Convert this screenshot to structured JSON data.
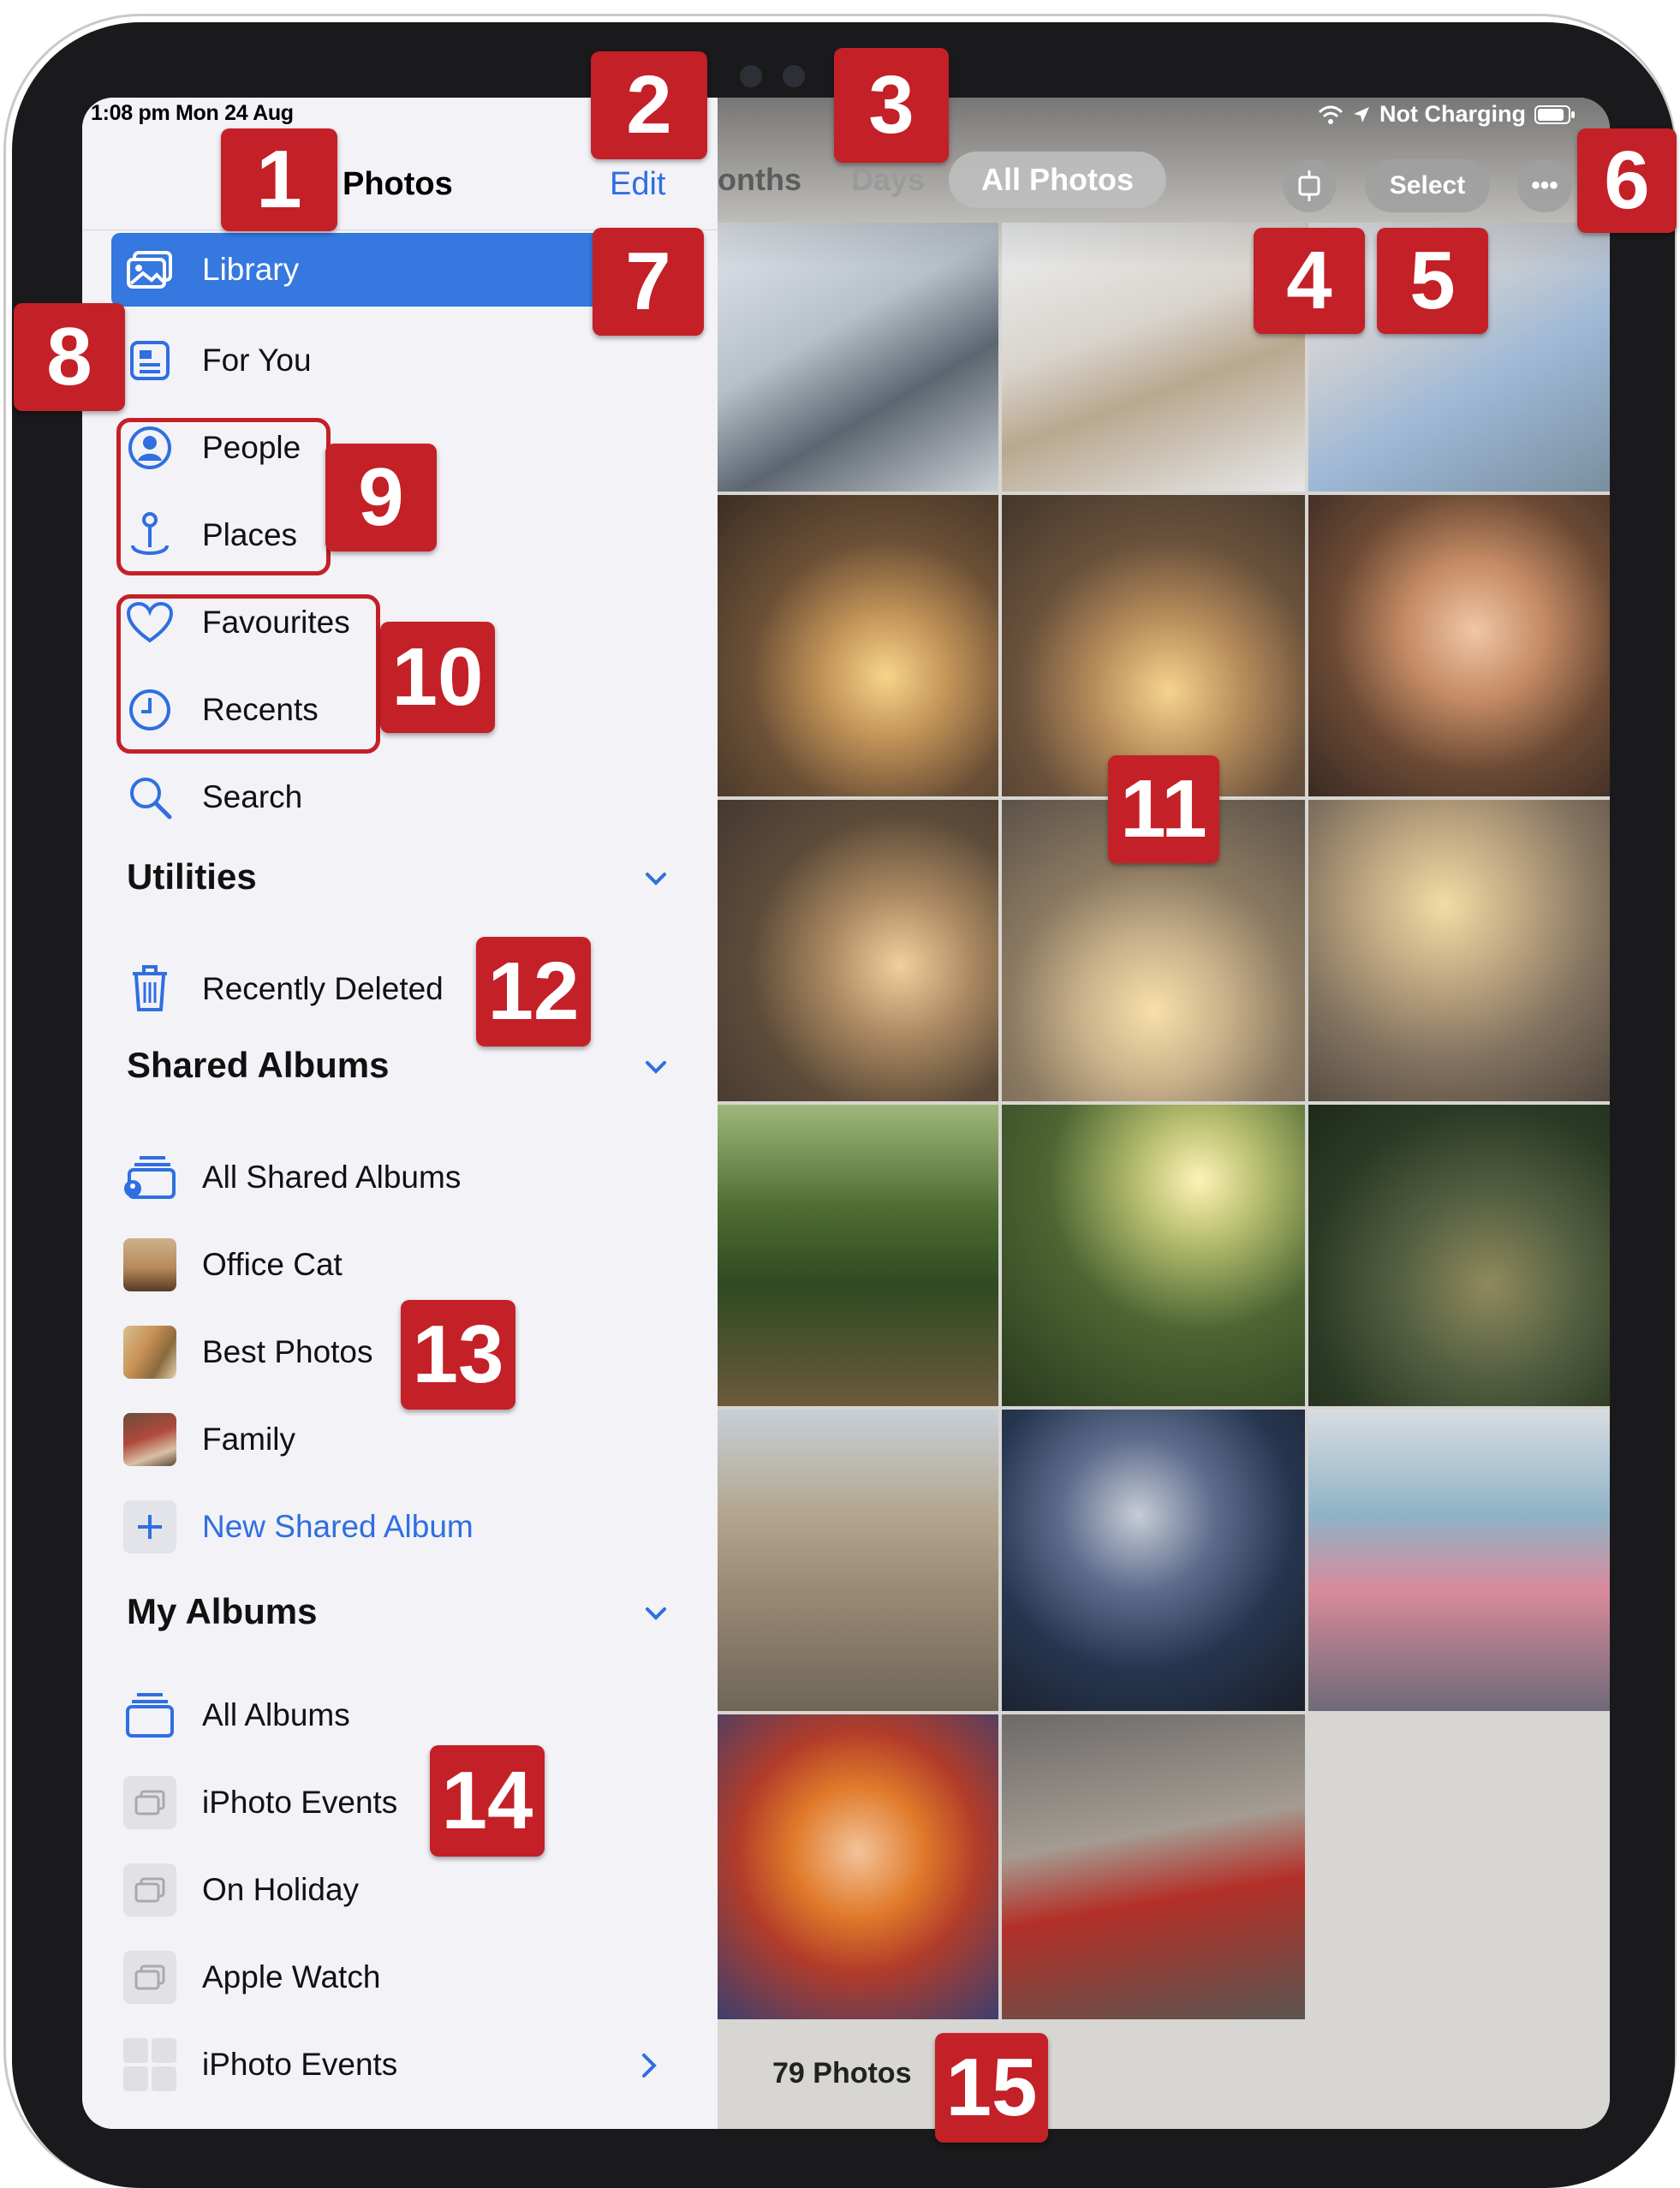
{
  "status_bar": {
    "time_date": "1:08 pm  Mon 24 Aug",
    "charging": "Not Charging"
  },
  "sidebar": {
    "title": "Photos",
    "edit_label": "Edit",
    "items": [
      {
        "label": "Library",
        "icon": "library-icon"
      },
      {
        "label": "For You",
        "icon": "for-you-icon"
      },
      {
        "label": "People",
        "icon": "people-icon"
      },
      {
        "label": "Places",
        "icon": "places-icon"
      },
      {
        "label": "Favourites",
        "icon": "heart-icon"
      },
      {
        "label": "Recents",
        "icon": "clock-icon"
      },
      {
        "label": "Search",
        "icon": "search-icon"
      }
    ],
    "utilities": {
      "heading": "Utilities",
      "items": [
        {
          "label": "Recently Deleted",
          "icon": "trash-icon"
        }
      ]
    },
    "shared_albums": {
      "heading": "Shared Albums",
      "items": [
        {
          "label": "All Shared Albums",
          "icon": "shared-albums-icon"
        },
        {
          "label": "Office Cat",
          "icon": "album-thumbnail"
        },
        {
          "label": "Best Photos",
          "icon": "album-thumbnail"
        },
        {
          "label": "Family",
          "icon": "album-thumbnail"
        },
        {
          "label": "New Shared Album",
          "icon": "plus-icon"
        }
      ]
    },
    "my_albums": {
      "heading": "My Albums",
      "items": [
        {
          "label": "All Albums",
          "icon": "albums-stack-icon"
        },
        {
          "label": "iPhoto Events",
          "icon": "photo-placeholder-icon"
        },
        {
          "label": "On Holiday",
          "icon": "photo-placeholder-icon"
        },
        {
          "label": "Apple Watch",
          "icon": "photo-placeholder-icon"
        },
        {
          "label": "iPhoto Events",
          "icon": "grid-placeholder-icon"
        }
      ]
    }
  },
  "photos_view": {
    "segments": [
      "onths",
      "Days",
      "All Photos"
    ],
    "selected_segment": "All Photos",
    "select_label": "Select",
    "more_label": "•••",
    "photo_count": "79 Photos"
  },
  "annotations": [
    "1",
    "2",
    "3",
    "4",
    "5",
    "6",
    "7",
    "8",
    "9",
    "10",
    "11",
    "12",
    "13",
    "14",
    "15"
  ],
  "colors": {
    "accent": "#2f6fe0",
    "selected_row": "#3478e0",
    "badge": "#c42027"
  }
}
